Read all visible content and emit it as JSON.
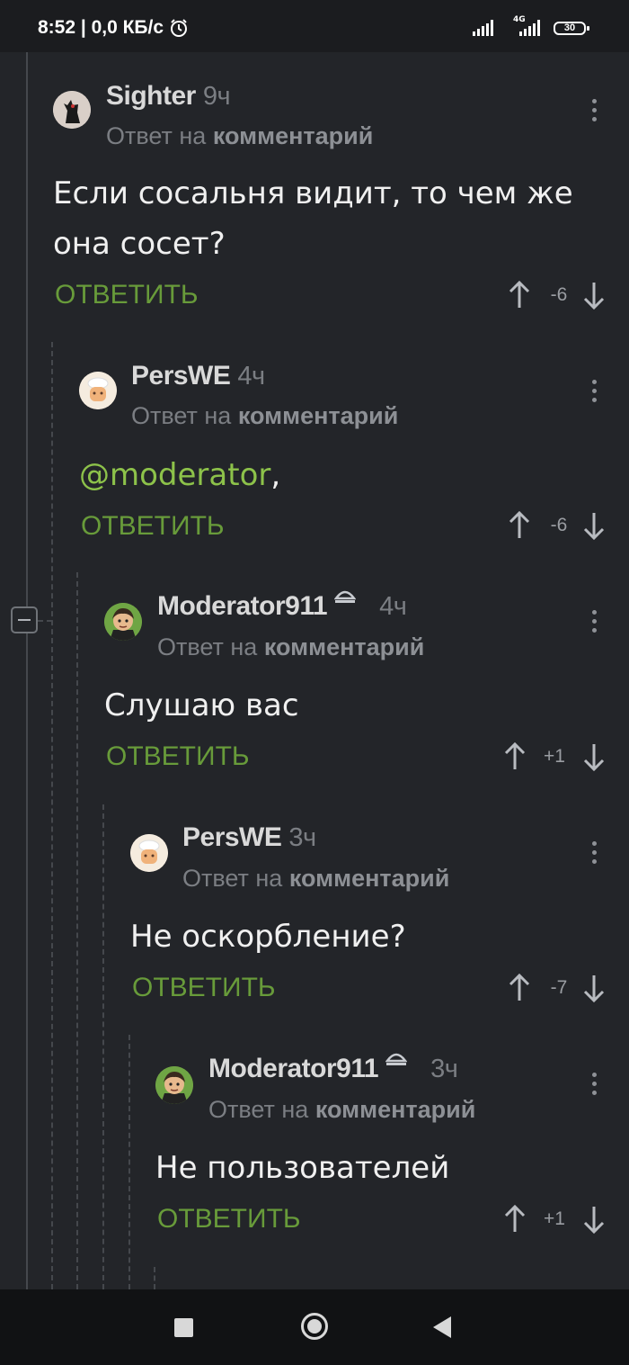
{
  "status": {
    "time": "8:52 | 0,0 КБ/с",
    "network_tag": "4G",
    "battery": "30"
  },
  "comments": [
    {
      "author": "Sighter",
      "time": "9ч",
      "reply_prefix": "Ответ на",
      "reply_target": "комментарий",
      "text": "Если сосальня видит, то чем же она сосет?",
      "reply_label": "ОТВЕТИТЬ",
      "score": "-6"
    },
    {
      "author": "PersWE",
      "time": "4ч",
      "reply_prefix": "Ответ на",
      "reply_target": "комментарий",
      "mention": "@moderator",
      "text": ",",
      "reply_label": "ОТВЕТИТЬ",
      "score": "-6"
    },
    {
      "author": "Moderator911",
      "time": "4ч",
      "reply_prefix": "Ответ на",
      "reply_target": "комментарий",
      "text": "Слушаю вас",
      "reply_label": "ОТВЕТИТЬ",
      "score": "+1"
    },
    {
      "author": "PersWE",
      "time": "3ч",
      "reply_prefix": "Ответ на",
      "reply_target": "комментарий",
      "text": "Не оскорбление?",
      "reply_label": "ОТВЕТИТЬ",
      "score": "-7"
    },
    {
      "author": "Moderator911",
      "time": "3ч",
      "reply_prefix": "Ответ на",
      "reply_target": "комментарий",
      "text": "Не пользователей",
      "reply_label": "ОТВЕТИТЬ",
      "score": "+1"
    }
  ],
  "colors": {
    "background": "#232529",
    "reply_green": "#689b3a",
    "mention_green": "#8dc24a"
  },
  "icons": {
    "vote_up": "arrow-up-icon",
    "vote_down": "arrow-down-icon",
    "menu": "more-vertical-icon",
    "moderator_badge": "moderator-badge-icon",
    "collapse": "collapse-thread-icon"
  }
}
